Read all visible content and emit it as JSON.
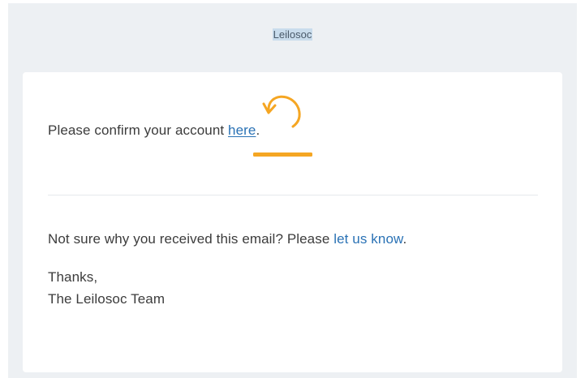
{
  "header": {
    "brand": "Leilosoc"
  },
  "email": {
    "confirm_prefix": "Please confirm your account ",
    "confirm_link": "here",
    "confirm_suffix": ".",
    "unsure_prefix": "Not sure why you received this email? Please ",
    "unsure_link": "let us know",
    "unsure_suffix": ".",
    "signoff": "Thanks,",
    "signature": "The Leilosoc Team"
  },
  "annotation": {
    "color": "#f5a623",
    "icon": "curved-arrow-icon"
  }
}
